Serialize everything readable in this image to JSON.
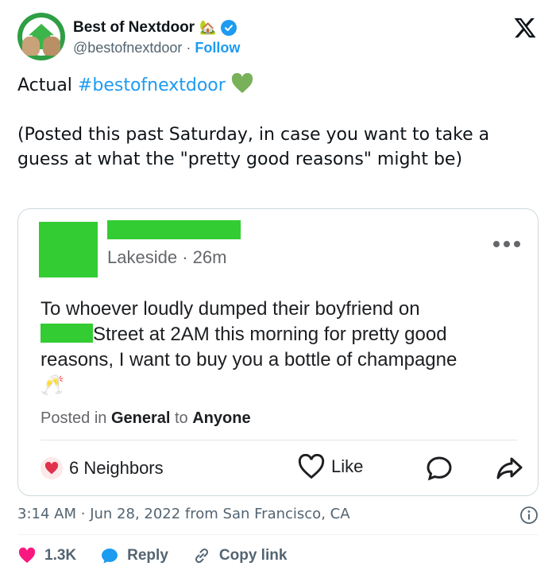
{
  "author": {
    "display_name": "Best of Nextdoor",
    "handle": "@bestofnextdoor",
    "separator": "·",
    "follow_label": "Follow"
  },
  "tweet": {
    "prefix": "Actual ",
    "hashtag": "#bestofnextdoor",
    "paragraph2": "(Posted this past Saturday, in case you want to take a guess at what the \"pretty good reasons\" might be)"
  },
  "nextdoor_post": {
    "location": "Lakeside",
    "separator": "·",
    "time": "26m",
    "body_line1": "To whoever loudly dumped their boyfriend on",
    "body_line2_after_redaction": "Street at 2AM this morning for pretty good",
    "body_line3": "reasons, I want to buy you a bottle of champagne",
    "body_emoji": "🥂",
    "posted_prefix": "Posted in ",
    "posted_category": "General",
    "posted_to": " to ",
    "posted_audience": "Anyone",
    "reactions_label": "6 Neighbors",
    "like_label": "Like"
  },
  "meta": {
    "time": "3:14 AM",
    "dot": "·",
    "date_location": "Jun 28, 2022 from San Francisco, CA"
  },
  "footer": {
    "likes": "1.3K",
    "reply_label": "Reply",
    "copy_link_label": "Copy link"
  },
  "colors": {
    "accent_blue": "#1d9bf0",
    "like_pink": "#f91880",
    "redaction_green": "#33cc33",
    "heart_green": "#78b159"
  }
}
